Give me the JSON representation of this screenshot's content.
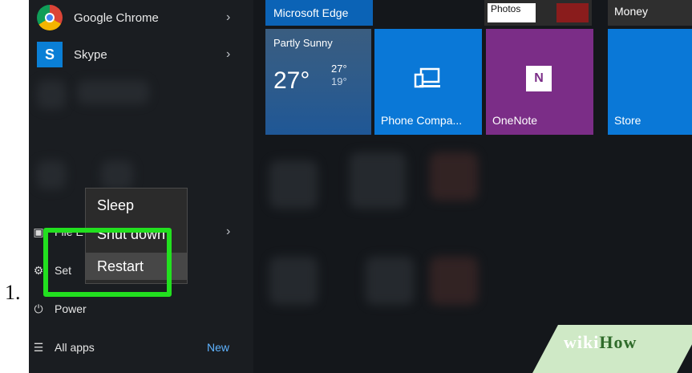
{
  "list_marker": "1.",
  "start_menu": {
    "apps": [
      {
        "label": "Google Chrome",
        "icon": "chrome-icon"
      },
      {
        "label": "Skype",
        "icon": "skype-icon",
        "icon_glyph": "S"
      }
    ],
    "side_items": [
      {
        "label": "File E",
        "icon": "file-explorer-icon"
      },
      {
        "label": "Set",
        "icon": "settings-icon"
      },
      {
        "label": "Power",
        "icon": "power-icon"
      },
      {
        "label": "All apps",
        "icon": "all-apps-icon",
        "badge": "New"
      }
    ]
  },
  "power_menu": {
    "items": [
      "Sleep",
      "Shut down",
      "Restart"
    ],
    "highlighted": "Restart"
  },
  "tiles": {
    "edge": {
      "label": "Microsoft Edge",
      "color": "#0b63b6"
    },
    "photos": {
      "label": "Photos"
    },
    "money": {
      "label": "Money"
    },
    "weather": {
      "condition": "Partly Sunny",
      "temp": "27°",
      "high": "27°",
      "low": "19°"
    },
    "phone": {
      "label": "Phone Compa...",
      "color": "#0a78d7"
    },
    "onenote": {
      "label": "OneNote",
      "color": "#7b2d87"
    },
    "store": {
      "label": "Store",
      "color": "#0a78d7"
    }
  },
  "highlight_color": "#22e01f",
  "watermark": {
    "part1": "wiki",
    "part2": "How"
  }
}
